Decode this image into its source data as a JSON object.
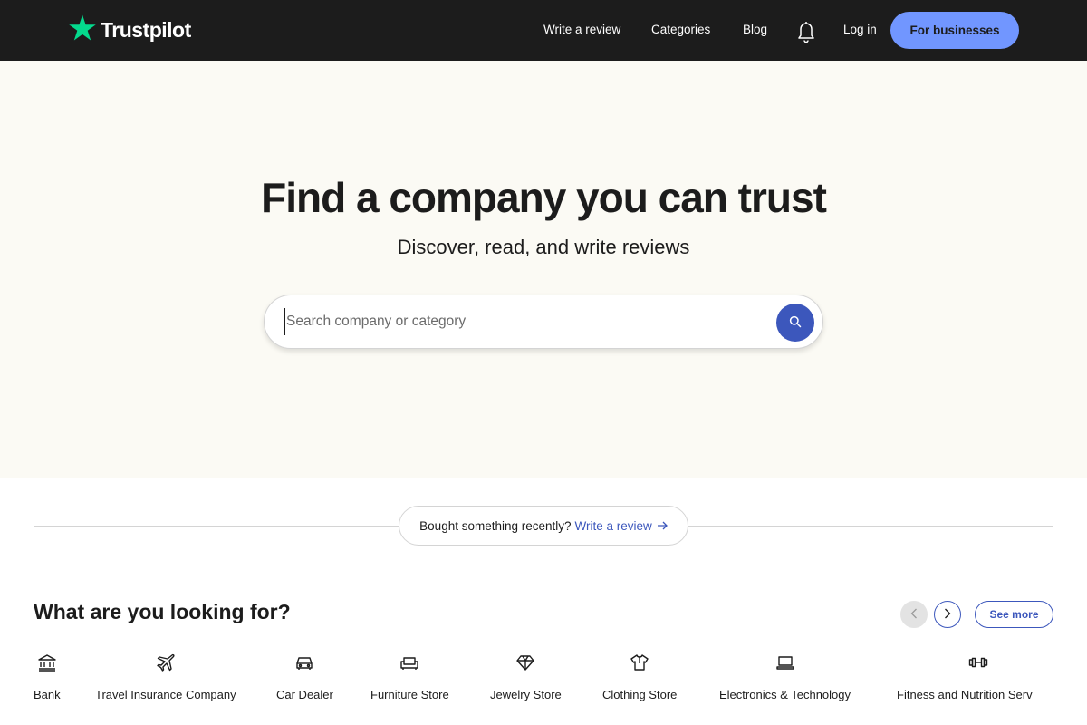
{
  "header": {
    "logo_text": "Trustpilot",
    "logo_icon": "star-icon",
    "nav": {
      "write_review": "Write a review",
      "categories": "Categories",
      "blog": "Blog",
      "notifications_icon": "bell-icon",
      "login": "Log in",
      "for_businesses": "For businesses"
    }
  },
  "hero": {
    "title": "Find a company you can trust",
    "subtitle": "Discover, read, and write reviews",
    "search": {
      "placeholder": "Search company or category",
      "value": "",
      "button_icon": "search-icon"
    }
  },
  "review_prompt": {
    "text": "Bought something recently?",
    "link": "Write a review"
  },
  "categories": {
    "title": "What are you looking for?",
    "prev_icon": "chevron-left-icon",
    "next_icon": "chevron-right-icon",
    "see_more": "See more",
    "items": [
      {
        "label": "Bank",
        "icon": "bank-icon"
      },
      {
        "label": "Travel Insurance Company",
        "icon": "airplane-icon"
      },
      {
        "label": "Car Dealer",
        "icon": "car-icon"
      },
      {
        "label": "Furniture Store",
        "icon": "sofa-icon"
      },
      {
        "label": "Jewelry Store",
        "icon": "diamond-icon"
      },
      {
        "label": "Clothing Store",
        "icon": "shirt-icon"
      },
      {
        "label": "Electronics & Technology",
        "icon": "laptop-icon"
      },
      {
        "label": "Fitness and Nutrition Serv",
        "icon": "dumbbell-icon"
      }
    ]
  },
  "colors": {
    "header_bg": "#1c1c1c",
    "brand_green": "#04da8d",
    "business_button": "#7196ff",
    "accent_blue": "#3c57bc",
    "hero_bg": "#fbfaf4"
  }
}
